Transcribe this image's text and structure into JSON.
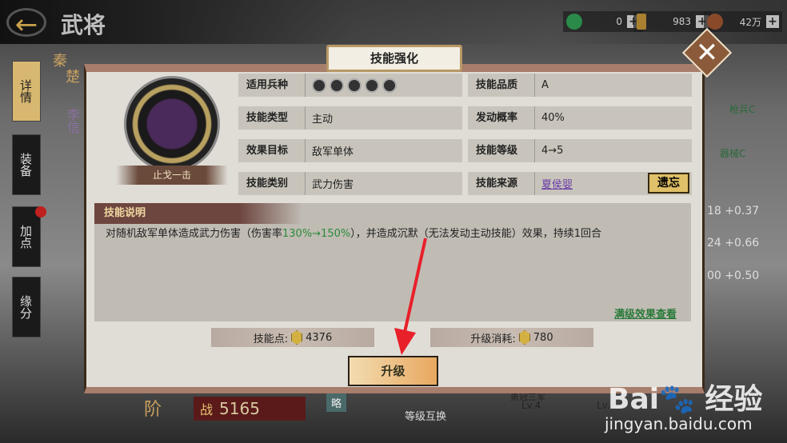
{
  "header": {
    "title": "武将",
    "back_icon": "back-arrow-icon",
    "resources": [
      {
        "icon": "jade-coin-icon",
        "value": "0"
      },
      {
        "icon": "bronze-figure-icon",
        "value": "983"
      },
      {
        "icon": "copper-coin-icon",
        "value": "42万"
      }
    ]
  },
  "side_tabs": [
    "详情",
    "装备",
    "加点",
    "缘分"
  ],
  "background": {
    "faction_1": "秦",
    "faction_2": "楚",
    "general": "李信",
    "troop_1": "枪兵C",
    "troop_2": "器械C",
    "stats": [
      {
        "v": "18",
        "d": "+0.37"
      },
      {
        "v": "24",
        "d": "+0.66"
      },
      {
        "v": "00",
        "d": "+0.50"
      }
    ],
    "power_label": "战",
    "power": "5165",
    "strategy": "略",
    "level_swap": "等级互换",
    "skill_1": "勇冠三军",
    "skill_1_lv": "Lv.4",
    "skill_2_lv": "Lv.4",
    "rank": "阶"
  },
  "dialog": {
    "title": "技能强化",
    "skill_name": "止戈一击",
    "rows_left": [
      {
        "k": "适用兵种",
        "v": ""
      },
      {
        "k": "技能类型",
        "v": "主动"
      },
      {
        "k": "效果目标",
        "v": "敌军单体"
      },
      {
        "k": "技能类别",
        "v": "武力伤害"
      }
    ],
    "troop_icons": [
      "cavalry-icon",
      "shield-icon",
      "archer-icon",
      "spear-icon",
      "siege-icon"
    ],
    "rows_right": [
      {
        "k": "技能品质",
        "v": "A"
      },
      {
        "k": "发动概率",
        "v": "40%"
      },
      {
        "k": "技能等级",
        "v": "4→5"
      },
      {
        "k": "技能来源",
        "v": "夏侯婴"
      }
    ],
    "yizhi_button": "遗忘",
    "desc_title": "技能说明",
    "desc_pre": "对随机敌军单体造成武力伤害（伤害率",
    "desc_green": "130%→150%",
    "desc_post": "），并造成沉默（无法发动主动技能）效果，持续1回合",
    "max_link": "满级效果查看",
    "points_label": "技能点:",
    "points": "4376",
    "cost_label": "升级消耗:",
    "cost": "780",
    "upgrade_button": "升级"
  },
  "watermark": {
    "brand": "Baidu经验",
    "url": "jingyan.baidu.com"
  },
  "colors": {
    "accent_green": "#2a8a3a",
    "header_brown": "#6e4640",
    "arrow_red": "#e8202a"
  }
}
